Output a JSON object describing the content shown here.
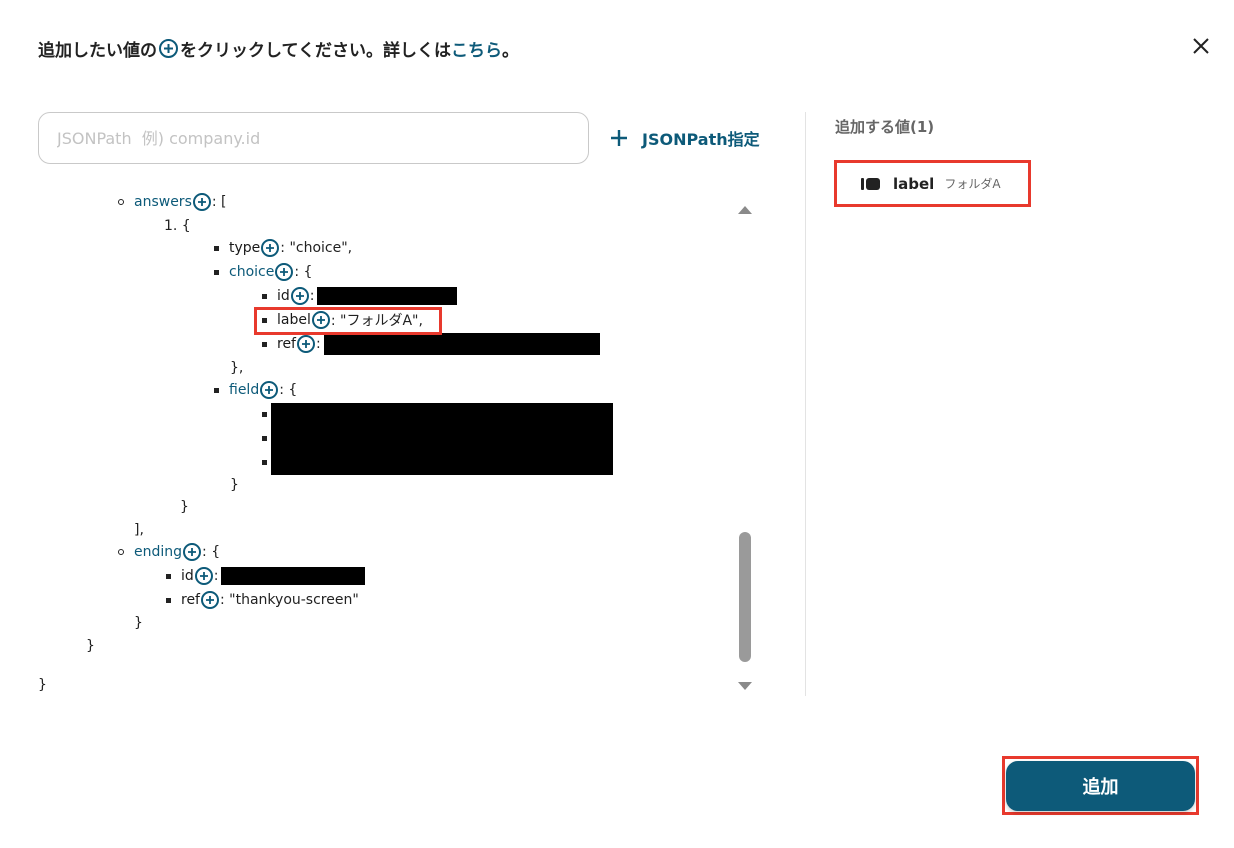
{
  "header": {
    "instruction_prefix": "追加したい値の",
    "instruction_suffix": "をクリックしてください。詳しくは",
    "link_text": "こちら",
    "period": "。"
  },
  "search": {
    "placeholder": "JSONPath  例) company.id",
    "value": ""
  },
  "jsonpath_button": {
    "label": "JSONPath指定"
  },
  "tree": {
    "answers_key": "answers",
    "answers_open": ": [",
    "item_index": "1. {",
    "type_key": "type",
    "type_value": ": \"choice\",",
    "choice_key": "choice",
    "choice_open": ": {",
    "id_key": "id",
    "colon": ":",
    "label_key": "label",
    "label_value": ": \"フォルダA\",",
    "ref_key": "ref",
    "choice_close": "},",
    "field_key": "field",
    "field_open": ": {",
    "field_close": "}",
    "item_close": "}",
    "answers_close": "],",
    "ending_key": "ending",
    "ending_open": ": {",
    "ending_id_key": "id",
    "ending_ref_key": "ref",
    "ending_ref_value": ": \"thankyou-screen\"",
    "ending_close": "}",
    "outer_close": "}",
    "root_close": "}"
  },
  "selected_panel": {
    "title": "追加する値(1)",
    "items": [
      {
        "key": "label",
        "value": "フォルダA"
      }
    ]
  },
  "footer": {
    "add_button": "追加"
  },
  "colors": {
    "accent": "#0d5a79",
    "highlight": "#e8392d"
  }
}
